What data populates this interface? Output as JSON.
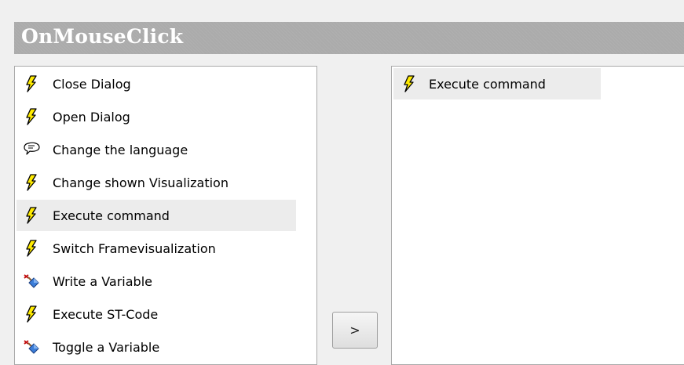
{
  "header": {
    "title": "OnMouseClick"
  },
  "available_actions": {
    "items": [
      {
        "label": "Close Dialog",
        "icon": "lightning-bolt-icon"
      },
      {
        "label": "Open Dialog",
        "icon": "lightning-bolt-icon"
      },
      {
        "label": "Change the language",
        "icon": "speech-bubble-icon"
      },
      {
        "label": "Change shown Visualization",
        "icon": "lightning-bolt-icon"
      },
      {
        "label": "Execute command",
        "icon": "lightning-bolt-icon",
        "selected": true
      },
      {
        "label": "Switch Framevisualization",
        "icon": "lightning-bolt-icon"
      },
      {
        "label": "Write a Variable",
        "icon": "write-variable-icon"
      },
      {
        "label": "Execute ST-Code",
        "icon": "lightning-bolt-icon"
      },
      {
        "label": "Toggle a Variable",
        "icon": "write-variable-icon"
      }
    ]
  },
  "move_button": {
    "label": ">"
  },
  "assigned_actions": {
    "items": [
      {
        "label": "Execute command",
        "icon": "lightning-bolt-icon",
        "selected": true
      }
    ]
  },
  "colors": {
    "header_background": "#ababab",
    "bolt_fill": "#ffeb00",
    "selection": "#ececec"
  }
}
